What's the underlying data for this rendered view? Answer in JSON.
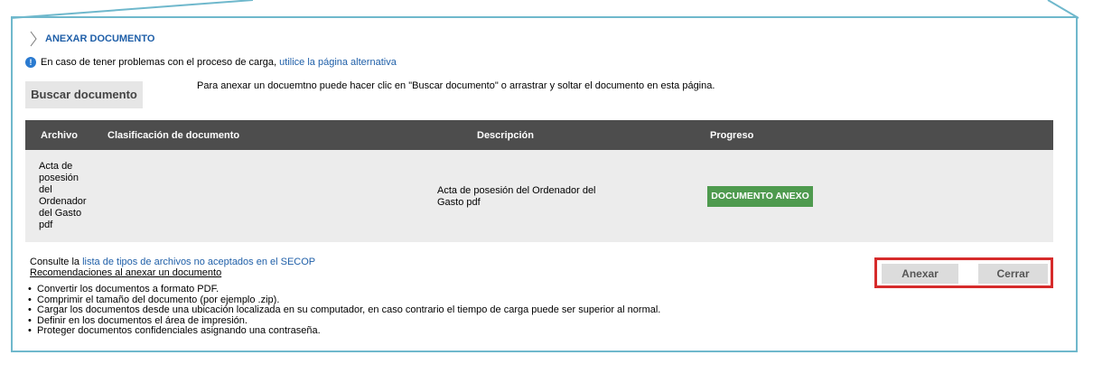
{
  "section": {
    "title": "ANEXAR DOCUMENTO"
  },
  "info": {
    "text": "En caso de tener problemas con el proceso de carga,",
    "link": "utilice la página alternativa"
  },
  "upload": {
    "button_label": "Buscar documento",
    "help_text": "Para anexar un docuemtno puede hacer clic en \"Buscar documento\" o arrastrar y soltar el documento en esta página."
  },
  "table": {
    "headers": [
      "Archivo",
      "Clasificación de documento",
      "Descripción",
      "Progreso"
    ],
    "rows": [
      {
        "archivo": "Acta de posesión del Ordenador del Gasto pdf",
        "clasificacion": "",
        "descripcion": "Acta de posesión del Ordenador del Gasto pdf",
        "progreso": "DOCUMENTO ANEXO"
      }
    ]
  },
  "footer": {
    "consult_prefix": "Consulte la",
    "consult_link": "lista de tipos de archivos no aceptados en el SECOP",
    "recommendations_title": "Recomendaciones al anexar un documento",
    "recommendations": [
      "Convertir los documentos a formato PDF.",
      "Comprimir el tamaño del documento (por ejemplo .zip).",
      "Cargar los documentos desde una ubicación localizada en su computador, en caso contrario el tiempo de carga puede ser superior al normal.",
      "Definir en los documentos el área de impresión.",
      "Proteger documentos confidenciales asignando una contraseña."
    ]
  },
  "actions": {
    "anexar_label": "Anexar",
    "cerrar_label": "Cerrar"
  },
  "colors": {
    "accent_link": "#1f5fa8",
    "frame": "#6fb8cc",
    "header_bg": "#4d4d4d",
    "badge_green": "#4e9a4e",
    "highlight_red": "#d62b2b"
  }
}
